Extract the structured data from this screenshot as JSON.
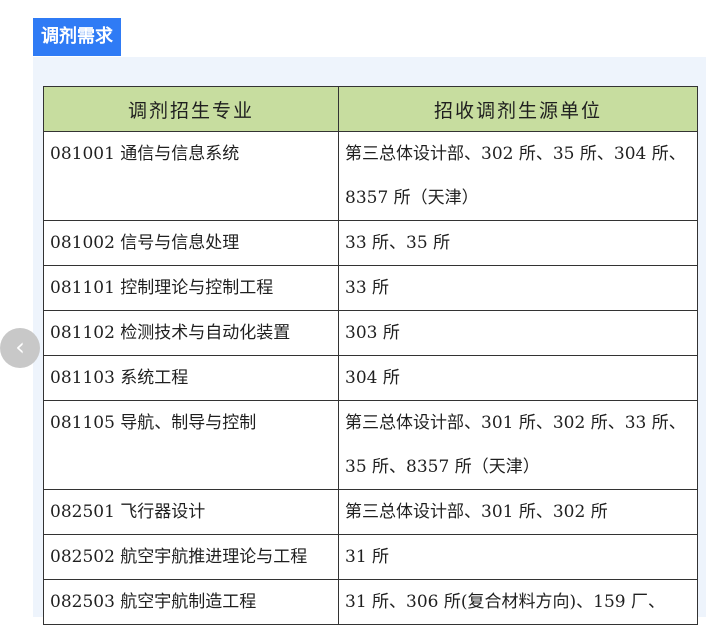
{
  "section_title": "调剂需求",
  "table": {
    "headers": [
      "调剂招生专业",
      "招收调剂生源单位"
    ],
    "rows": [
      [
        "081001 通信与信息系统",
        "第三总体设计部、302 所、35 所、304 所、8357 所（天津）"
      ],
      [
        "081002 信号与信息处理",
        "33 所、35 所"
      ],
      [
        "081101 控制理论与控制工程",
        "33 所"
      ],
      [
        "081102 检测技术与自动化装置",
        "303 所"
      ],
      [
        "081103 系统工程",
        "304 所"
      ],
      [
        "081105 导航、制导与控制",
        "第三总体设计部、301 所、302 所、33 所、35 所、8357 所（天津）"
      ],
      [
        "082501 飞行器设计",
        "第三总体设计部、301 所、302 所"
      ],
      [
        "082502 航空宇航推进理论与工程",
        "31 所"
      ],
      [
        "082503 航空宇航制造工程",
        "31 所、306 所(复合材料方向)、159 厂、"
      ]
    ]
  },
  "nav": {
    "prev_icon": "chevron-left-icon",
    "prev_glyph": "‹"
  }
}
